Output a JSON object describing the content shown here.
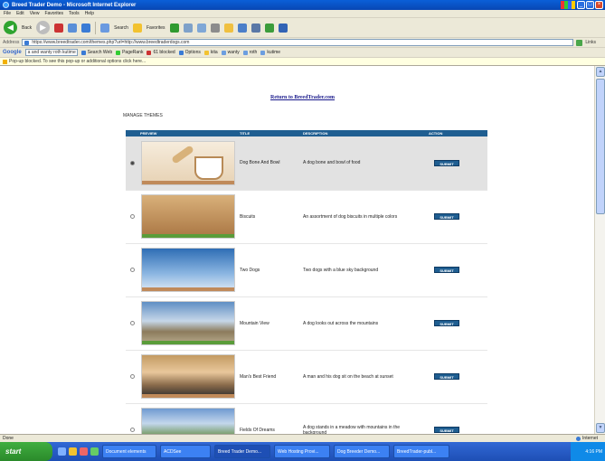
{
  "window": {
    "title": "Breed Trader Demo - Microsoft Internet Explorer"
  },
  "menu": [
    "File",
    "Edit",
    "View",
    "Favorites",
    "Tools",
    "Help"
  ],
  "toolbar": {
    "back_label": "Back",
    "search_label": "Search",
    "favorites_label": "Favorites"
  },
  "address": {
    "label": "Address",
    "url": "https://www.breedtrader.com/themes.php?url=http://www.breedtraderdogs.com",
    "links_label": "Links"
  },
  "google": {
    "logo": "Google",
    "query": "a and wanty roth kutime",
    "search_web": "Search Web",
    "pagerank": "PageRank",
    "blocked": "61 blocked",
    "options": "Options",
    "items": [
      "kita",
      "wanty",
      "roth",
      "kutime"
    ]
  },
  "infobar": {
    "text": "Pop-up blocked. To see this pop-up or additional options click here..."
  },
  "page": {
    "return_link": "Return to BreedTrader.com",
    "section_label": "MANAGE THEMES",
    "table_headers": {
      "preview": "PREVIEW",
      "title": "TITLE",
      "description": "DESCRIPTION",
      "action": "ACTION"
    },
    "select_label": "SUBMIT",
    "themes": [
      {
        "title": "Dog Bone And Bowl",
        "description": "A dog bone and bowl of food"
      },
      {
        "title": "Biscuits",
        "description": "An assortment of dog biscuits in multiple colors"
      },
      {
        "title": "Two Dogs",
        "description": "Two dogs with a blue sky background"
      },
      {
        "title": "Mountain View",
        "description": "A dog looks out across the mountains"
      },
      {
        "title": "Man's Best Friend",
        "description": "A man and his dog sit on the beach at sunset"
      },
      {
        "title": "Fields Of Dreams",
        "description": "A dog stands in a meadow with mountains in the background"
      }
    ]
  },
  "statusbar": {
    "status": "Done",
    "zone": "Internet"
  },
  "taskbar": {
    "start_label": "start",
    "tasks": [
      "Document elements",
      "ACDSee",
      "Breed Trader Demo...",
      "Web Hosting Provi...",
      "Dog Breeder Demo...",
      "BreedTrader-publ..."
    ],
    "clock": "4:16 PM"
  },
  "colors": {
    "table_header": "#1f5e91",
    "button": "#1f5e91",
    "titlebar": "#0a5fd8"
  }
}
